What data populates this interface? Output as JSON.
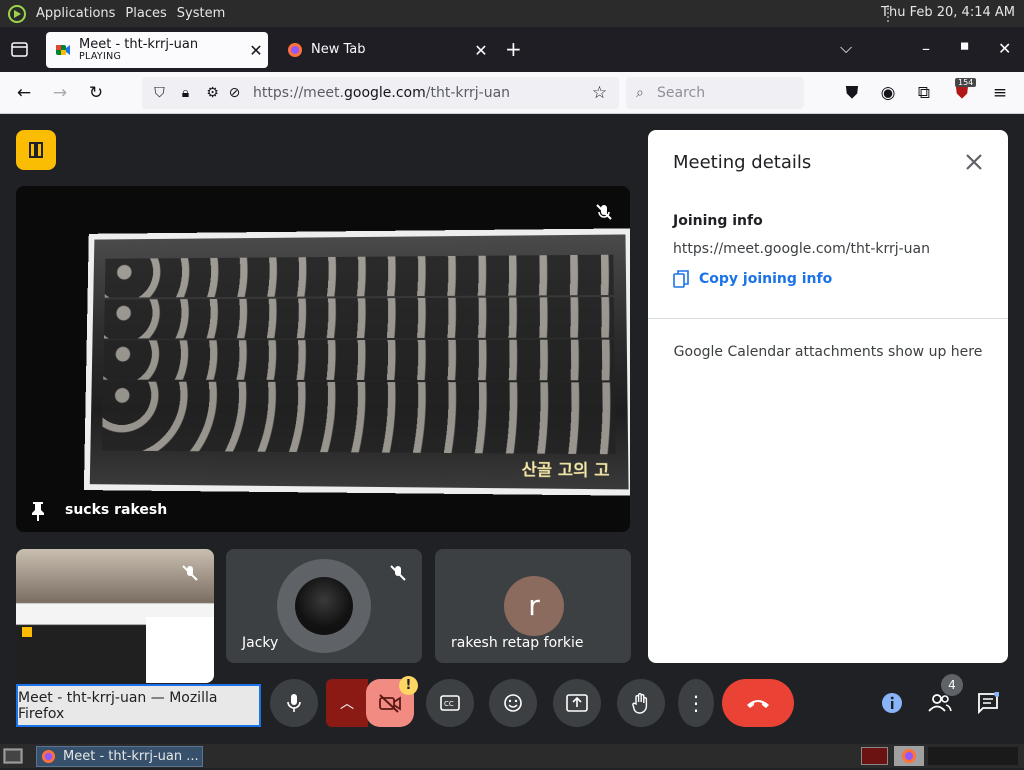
{
  "panel": {
    "menus": [
      "Applications",
      "Places",
      "System"
    ],
    "clock": "Thu Feb 20,  4:14 AM"
  },
  "browser": {
    "tabs": [
      {
        "title": "Meet - tht-krrj-uan",
        "subtitle": "PLAYING",
        "active": true
      },
      {
        "title": "New Tab",
        "active": false
      }
    ],
    "url_prefix": "https://meet.",
    "url_domain": "google.com",
    "url_path": "/tht-krrj-uan",
    "search_placeholder": "Search",
    "extension_badge": "154"
  },
  "meet": {
    "main_participant": "sucks rakesh",
    "main_caption": "산골 고의 고",
    "participants": [
      {
        "name": "Jacky"
      },
      {
        "name": "rakesh retap forkie",
        "initial": "r",
        "color": "#8a6b5e"
      }
    ],
    "people_count": "4",
    "tooltip": "Meet - tht-krrj-uan — Mozilla Firefox",
    "camera_warning": "!"
  },
  "side_panel": {
    "title": "Meeting details",
    "joining_label": "Joining info",
    "joining_link": "https://meet.google.com/tht-krrj-uan",
    "copy_label": "Copy joining info",
    "calendar_note": "Google Calendar attachments show up here"
  },
  "taskbar": {
    "window_label": "Meet - tht-krrj-uan ..."
  },
  "colors": {
    "meet_bg": "#202124",
    "accent_blue": "#1a73e8",
    "end_call_red": "#ea4335",
    "room_yellow": "#fbbc04"
  }
}
